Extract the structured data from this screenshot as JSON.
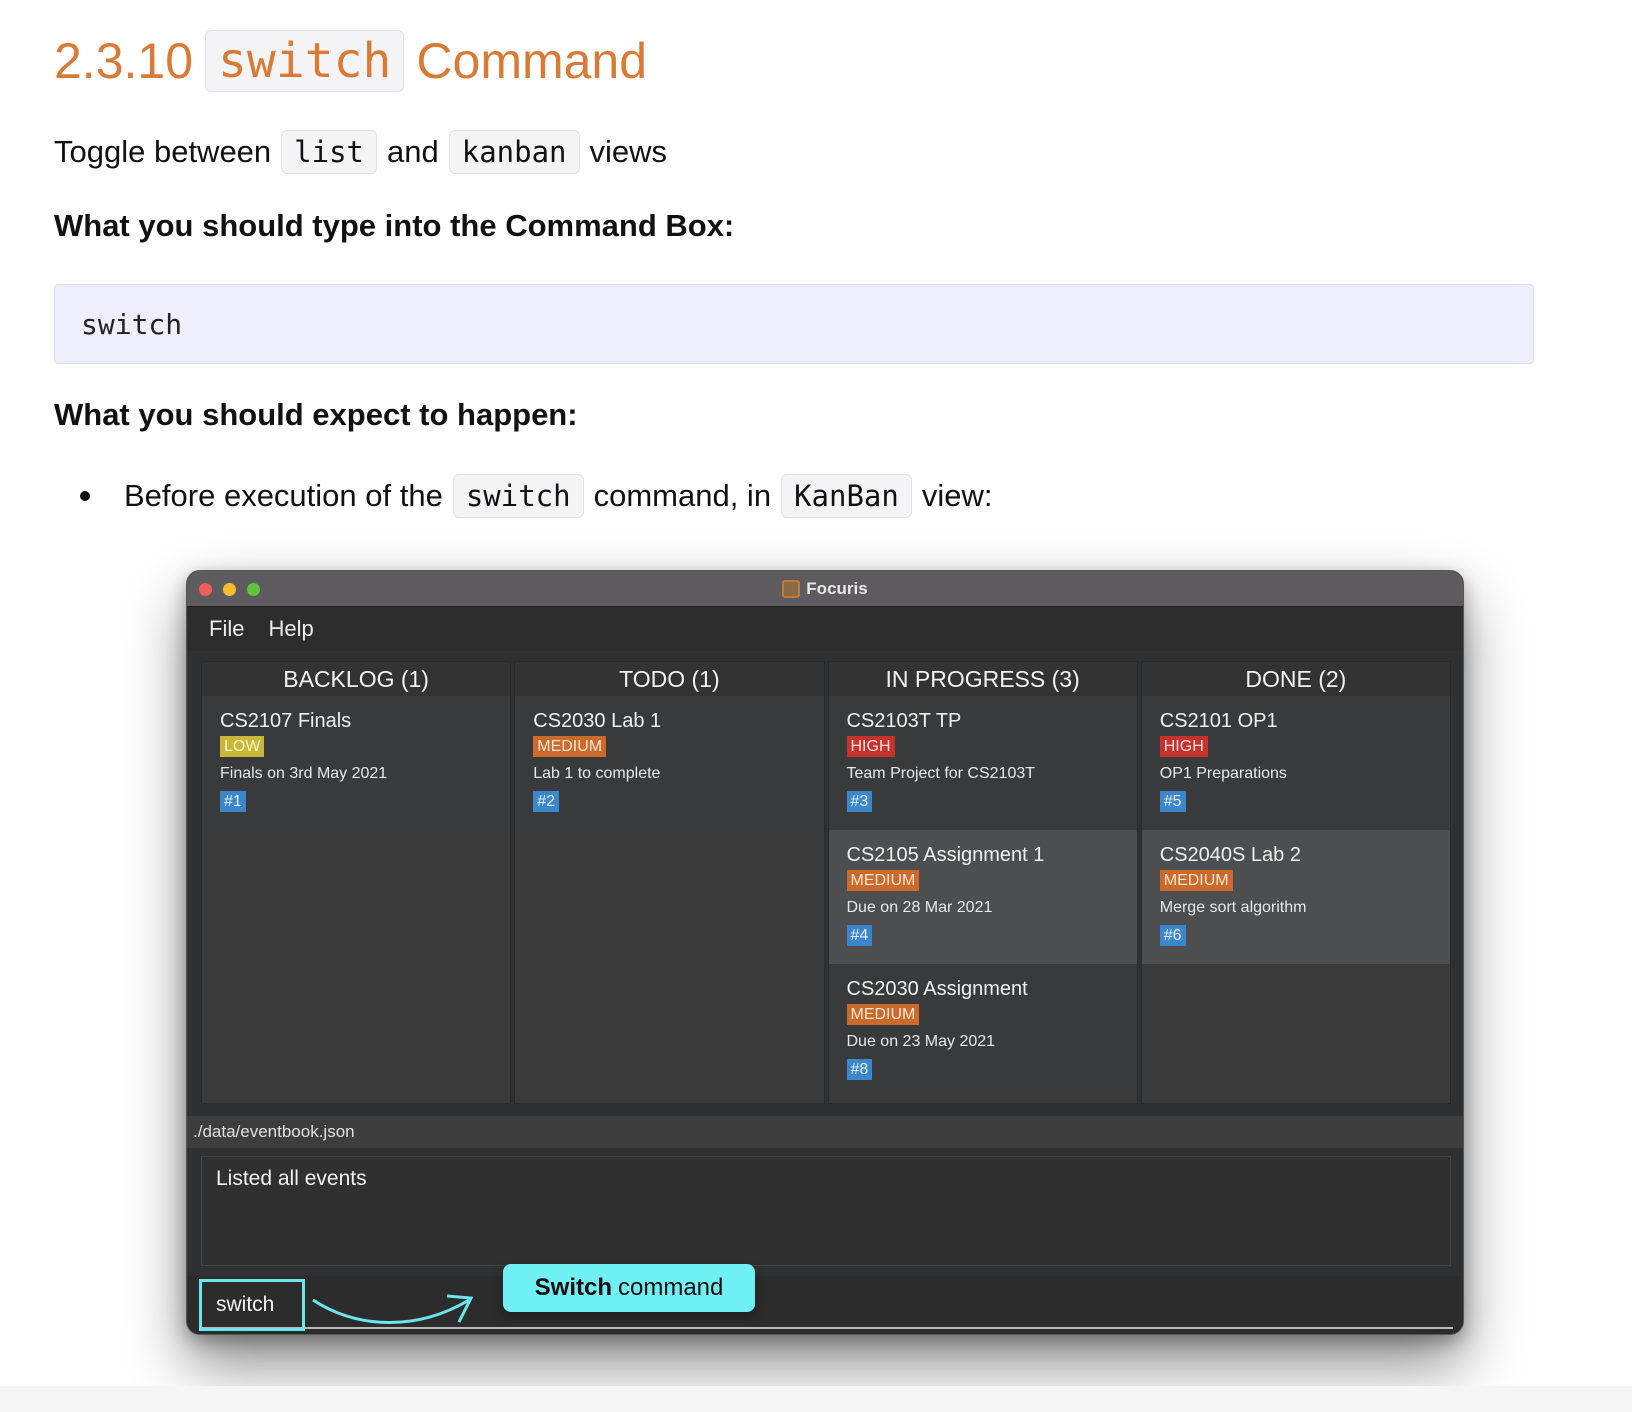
{
  "heading": {
    "number": "2.3.10",
    "code": "switch",
    "word": "Command"
  },
  "intro": {
    "prefix": "Toggle between",
    "code1": "list",
    "mid": "and",
    "code2": "kanban",
    "suffix": "views"
  },
  "type_heading": "What you should type into the Command Box:",
  "command_example": "switch",
  "expect_heading": "What you should expect to happen:",
  "bullet": {
    "prefix": "Before execution of the",
    "code1": "switch",
    "mid": "command, in",
    "code2": "KanBan",
    "suffix": "view:"
  },
  "app": {
    "title": "Focuris",
    "menu": [
      "File",
      "Help"
    ],
    "columns": [
      {
        "header": "BACKLOG (1)",
        "cards": [
          {
            "title": "CS2107 Finals",
            "priority": "LOW",
            "level": "low",
            "desc": "Finals on 3rd May 2021",
            "id": "#1"
          }
        ]
      },
      {
        "header": "TODO (1)",
        "cards": [
          {
            "title": "CS2030 Lab 1",
            "priority": "MEDIUM",
            "level": "medium",
            "desc": "Lab 1 to complete",
            "id": "#2"
          }
        ]
      },
      {
        "header": "IN PROGRESS (3)",
        "cards": [
          {
            "title": "CS2103T TP",
            "priority": "HIGH",
            "level": "high",
            "desc": "Team Project for CS2103T",
            "id": "#3"
          },
          {
            "title": "CS2105 Assignment 1",
            "priority": "MEDIUM",
            "level": "medium",
            "desc": "Due on 28 Mar 2021",
            "id": "#4"
          },
          {
            "title": "CS2030 Assignment",
            "priority": "MEDIUM",
            "level": "medium",
            "desc": "Due on 23 May 2021",
            "id": "#8"
          }
        ]
      },
      {
        "header": "DONE (2)",
        "cards": [
          {
            "title": "CS2101 OP1",
            "priority": "HIGH",
            "level": "high",
            "desc": "OP1 Preparations",
            "id": "#5"
          },
          {
            "title": "CS2040S Lab 2",
            "priority": "MEDIUM",
            "level": "medium",
            "desc": "Merge sort algorithm",
            "id": "#6"
          }
        ]
      }
    ],
    "file_path": "./data/eventbook.json",
    "result_text": "Listed all events",
    "command_input": "switch",
    "callout": {
      "bold": "Switch",
      "rest": "command"
    }
  }
}
